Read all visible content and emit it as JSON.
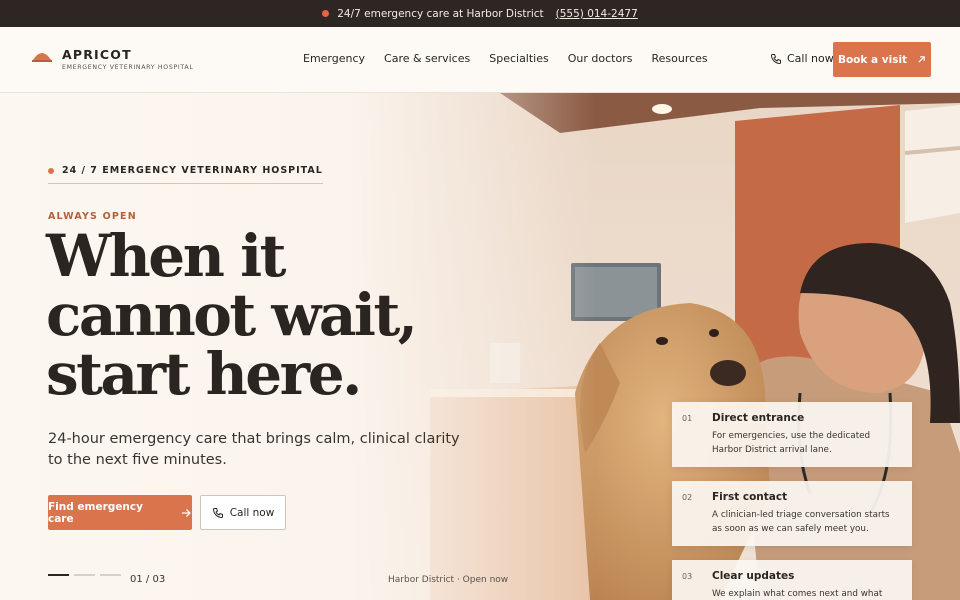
{
  "topbar": {
    "text": "24/7 emergency care at Harbor District",
    "phone": "(555) 014-2477"
  },
  "brand": {
    "name": "APRICOT",
    "tagline": "EMERGENCY VETERINARY HOSPITAL",
    "accent": "#d9744d"
  },
  "nav": {
    "items": [
      "Emergency",
      "Care & services",
      "Specialties",
      "Our doctors",
      "Resources"
    ],
    "call_label": "Call now",
    "book_label": "Book a visit"
  },
  "hero": {
    "badge": "24 / 7 EMERGENCY VETERINARY HOSPITAL",
    "eyebrow": "ALWAYS OPEN",
    "headline": [
      "When it",
      "cannot wait,",
      "start here."
    ],
    "subtitle": "24-hour emergency care that brings calm, clinical clarity to the next five minutes.",
    "primary_cta": "Find emergency care",
    "secondary_cta": "Call now",
    "slide_counter": "01 / 03",
    "location_status": "Harbor District · Open now"
  },
  "steps": [
    {
      "num": "01",
      "title": "Direct entrance",
      "body": "For emergencies, use the dedicated Harbor District arrival lane."
    },
    {
      "num": "02",
      "title": "First contact",
      "body": "A clinician-led triage conversation starts as soon as we can safely meet you."
    },
    {
      "num": "03",
      "title": "Clear updates",
      "body": "We explain what comes next and what needs"
    }
  ]
}
